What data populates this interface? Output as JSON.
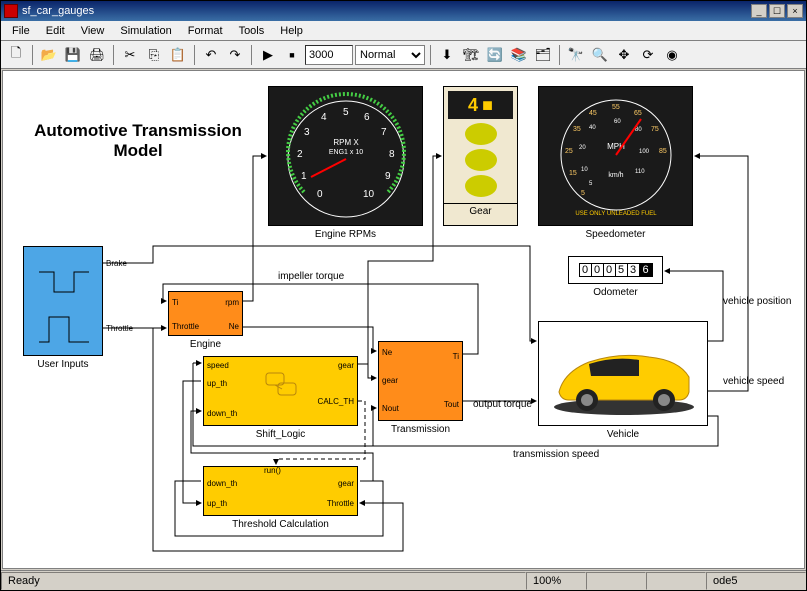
{
  "window": {
    "title": "sf_car_gauges",
    "controls": {
      "min": "_",
      "max": "☐",
      "close": "×"
    }
  },
  "menu": {
    "file": "File",
    "edit": "Edit",
    "view": "View",
    "simulation": "Simulation",
    "format": "Format",
    "tools": "Tools",
    "help": "Help"
  },
  "toolbar": {
    "stoptime": "3000",
    "mode": "Normal",
    "modes": [
      "Normal"
    ]
  },
  "icons": {
    "new": "🗋",
    "open": "📂",
    "save": "💾",
    "print": "🖨",
    "cut": "✂",
    "copy": "⎘",
    "paste": "📋",
    "undo": "↶",
    "redo": "↷",
    "play": "▶",
    "stop": "■",
    "step": "⬇",
    "build": "🏗",
    "update": "🔄",
    "lib": "📚",
    "explorer": "🗂",
    "find": "🔭",
    "zoom": "🔍",
    "pan": "✥",
    "refresh": "⟳",
    "debug": "◉"
  },
  "model": {
    "title": "Automotive Transmission Model",
    "blocks": {
      "user_inputs": "User Inputs",
      "engine": "Engine",
      "engine_rpm": "Engine RPMs",
      "transmission": "Transmission",
      "shift_logic": "Shift_Logic",
      "threshold_calc": "Threshold Calculation",
      "vehicle": "Vehicle",
      "speedometer": "Speedometer",
      "odometer": "Odometer",
      "gear_gauge": "Gear"
    },
    "ports": {
      "brake": "Brake",
      "throttle": "Throttle",
      "ti_in": "Ti",
      "throttle_in": "Throttle",
      "rpm": "rpm",
      "ne": "Ne",
      "ne_trans": "Ne",
      "gear_trans": "gear",
      "nout": "Nout",
      "ti_out": "Ti",
      "tout": "Tout",
      "speed": "speed",
      "up_th": "up_th",
      "down_th": "down_th",
      "gear_out": "gear",
      "calc_th": "CALC_TH",
      "run": "run()",
      "down_th2": "down_th",
      "up_th2": "up_th",
      "throttle2": "Throttle"
    },
    "signals": {
      "impeller_torque": "impeller torque",
      "output_torque": "output torque",
      "vehicle_position": "vehicle position",
      "vehicle_speed": "vehicle speed",
      "transmission_speed": "transmission speed"
    },
    "gauges": {
      "rpm_label1": "RPM X",
      "rpm_label2": "ENG1 x 10",
      "speed_mph": "MPH",
      "speed_kmh": "km/h",
      "speed_warning": "USE ONLY UNLEADED FUEL",
      "gear_value": "4",
      "odometer_value": "000536",
      "rpm_ticks": [
        "0",
        "1",
        "2",
        "3",
        "4",
        "5",
        "6",
        "7",
        "8",
        "9",
        "10"
      ],
      "speed_ticks_mph": [
        "5",
        "15",
        "25",
        "35",
        "45",
        "55",
        "65",
        "75",
        "85"
      ],
      "speed_ticks_kmh": [
        "5",
        "10",
        "20",
        "40",
        "60",
        "80",
        "100",
        "110"
      ]
    }
  },
  "status": {
    "ready": "Ready",
    "zoom": "100%",
    "empty": "",
    "solver": "ode5"
  }
}
